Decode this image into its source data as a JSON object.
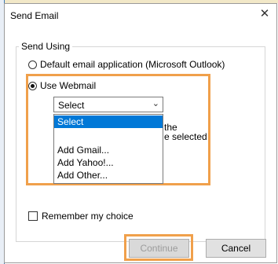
{
  "dialog": {
    "title": "Send Email",
    "close_glyph": "✕"
  },
  "send_using": {
    "legend": "Send Using",
    "option_default": "Default email application (Microsoft Outlook)",
    "option_webmail": "Use Webmail",
    "selected_option": "Use Webmail"
  },
  "webmail_select": {
    "value": "Select",
    "chevron_glyph": "⌄",
    "options": [
      "Select",
      "",
      "Add Gmail...",
      "Add Yahoo!...",
      "Add Other..."
    ]
  },
  "partially_hidden_text": {
    "line1": "the",
    "line2": "e selected"
  },
  "remember": {
    "label": "Remember my choice",
    "checked": false
  },
  "buttons": {
    "continue": "Continue",
    "cancel": "Cancel"
  },
  "colors": {
    "highlight": "#f0a04b",
    "selection": "#0078d7"
  }
}
